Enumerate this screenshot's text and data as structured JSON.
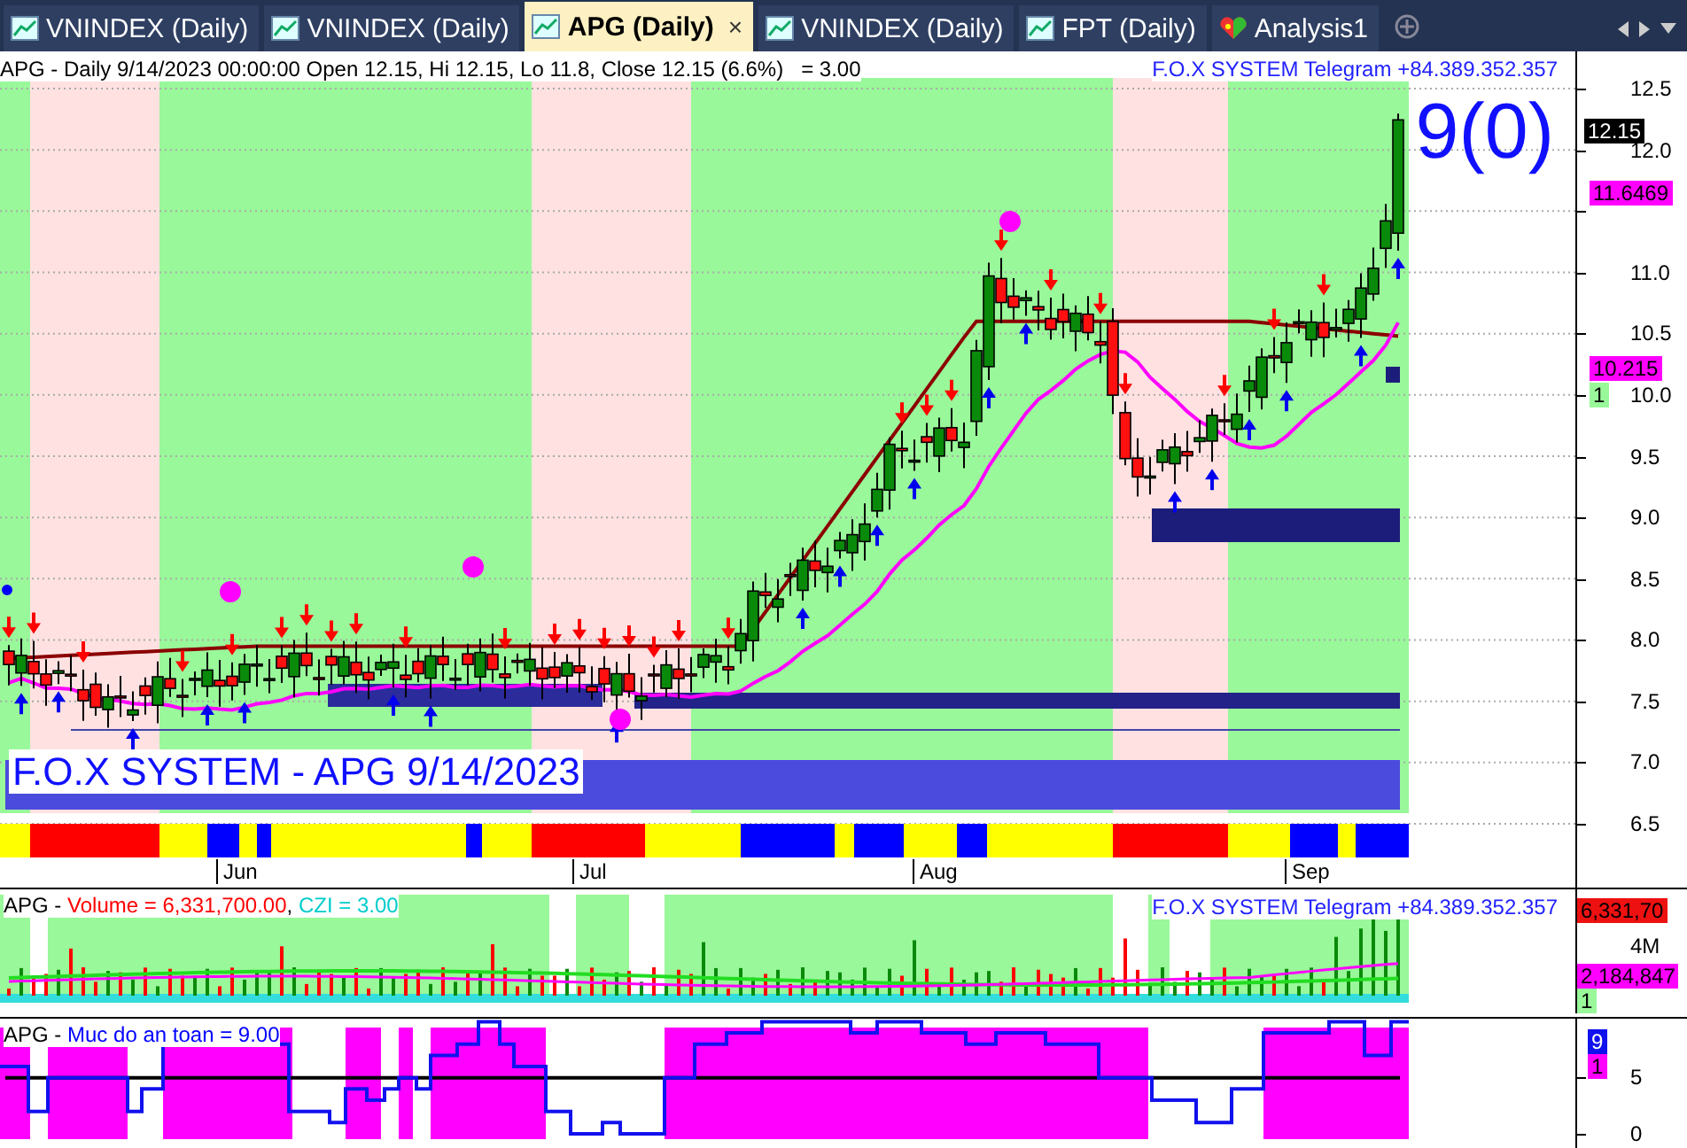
{
  "tabs": [
    {
      "label": "VNINDEX (Daily)",
      "kind": "chart",
      "selected": false
    },
    {
      "label": "VNINDEX (Daily)",
      "kind": "chart",
      "selected": false
    },
    {
      "label": "APG (Daily)",
      "kind": "chart",
      "selected": true,
      "close": "×"
    },
    {
      "label": "VNINDEX (Daily)",
      "kind": "chart",
      "selected": false
    },
    {
      "label": "FPT (Daily)",
      "kind": "chart",
      "selected": false
    },
    {
      "label": "Analysis1",
      "kind": "analysis",
      "selected": false
    }
  ],
  "price_pane": {
    "header": "APG - Daily 9/14/2023 00:00:00 Open 12.15, Hi 12.15, Lo 11.8, Close 12.15 (6.6%)   = 3.00",
    "promo": "F.O.X SYSTEM Telegram +84.389.352.357",
    "signal": "9(0)",
    "banner": "F.O.X SYSTEM - APG 9/14/2023",
    "axis": [
      "12.5",
      "12.0",
      "11.0",
      "10.5",
      "10.0",
      "9.5",
      "9.0",
      "8.5",
      "8.0",
      "7.5",
      "7.0",
      "6.5"
    ],
    "last_price": "12.15",
    "ma_fast": "11.6469",
    "ma_slow": "10.215",
    "count": "1"
  },
  "date_axis": [
    "Jun",
    "Jul",
    "Aug",
    "Sep"
  ],
  "volume_pane": {
    "header": [
      {
        "text": "APG - ",
        "color": "#000000"
      },
      {
        "text": "Volume = 6,331,700.00",
        "color": "#ff0000"
      },
      {
        "text": ", ",
        "color": "#000000"
      },
      {
        "text": "CZI = 3.00",
        "color": "#00cccc"
      }
    ],
    "promo": "F.O.X SYSTEM Telegram +84.389.352.357",
    "last_volume": "6,331,70",
    "tick": "4M",
    "average": "2,184,847",
    "count": "1"
  },
  "safety_pane": {
    "header": [
      {
        "text": "APG - ",
        "color": "#000000"
      },
      {
        "text": "Muc do an toan = 9.00",
        "color": "#0000ff"
      }
    ],
    "axis": [
      "5",
      "0"
    ],
    "value": "9",
    "count": "1"
  }
}
